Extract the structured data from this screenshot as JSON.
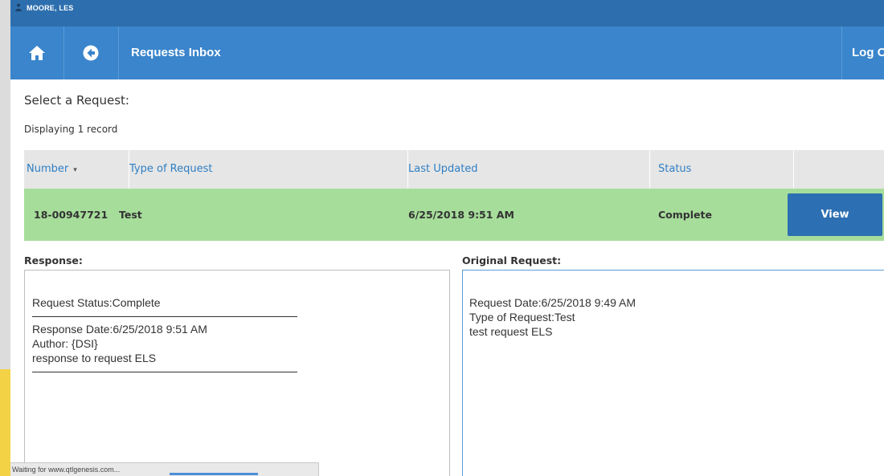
{
  "userbar": {
    "user_name": "MOORE, LES"
  },
  "navbar": {
    "title": "Requests Inbox",
    "logout_label": "Log Out"
  },
  "page": {
    "select_title": "Select a Request:",
    "record_count": "Displaying 1 record"
  },
  "table": {
    "headers": {
      "number": "Number",
      "type": "Type of Request",
      "updated": "Last Updated",
      "status": "Status"
    },
    "sort_indicator": "▾",
    "row": {
      "number": "18-00947721",
      "type": "Test",
      "updated": "6/25/2018 9:51 AM",
      "status": "Complete",
      "view_label": "View",
      "highlight_color": "#a6dd9a"
    }
  },
  "response": {
    "label": "Response:",
    "status_line": "Request Status:Complete",
    "date_line": "Response Date:6/25/2018 9:51 AM",
    "author_line": "Author: {DSI}",
    "body_line": "response to request ELS"
  },
  "original": {
    "label": "Original Request:",
    "date_line": "Request Date:6/25/2018 9:49 AM",
    "type_line": "Type of Request:Test",
    "body_line": "test request ELS"
  },
  "browser_status": {
    "text": "Waiting for www.qtlgenesis.com..."
  },
  "colors": {
    "nav": "#3a85cc",
    "userbar": "#2d6fae",
    "button": "#2c6fb2",
    "link": "#2f7fc4"
  },
  "icons": {
    "home": "home-icon",
    "back": "arrow-left-circle-icon",
    "user": "person-icon"
  }
}
